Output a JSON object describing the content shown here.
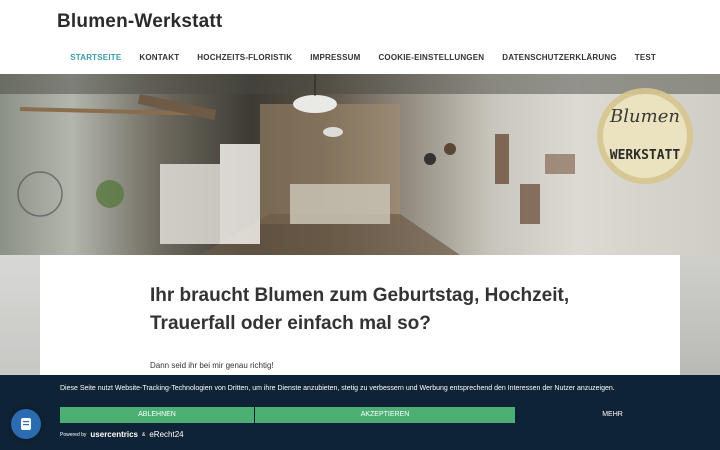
{
  "site": {
    "title": "Blumen-Werkstatt"
  },
  "nav": {
    "items": [
      {
        "label": "STARTSEITE",
        "active": true
      },
      {
        "label": "KONTAKT"
      },
      {
        "label": "HOCHZEITS-FLORISTIK"
      },
      {
        "label": "IMPRESSUM"
      },
      {
        "label": "COOKIE-EINSTELLUNGEN"
      },
      {
        "label": "DATENSCHUTZERKLÄRUNG"
      },
      {
        "label": "TEST"
      }
    ]
  },
  "hero": {
    "logo_text_1": "Blumen",
    "logo_text_2": "WERKSTATT"
  },
  "main": {
    "headline": "Ihr braucht Blumen zum Geburtstag, Hochzeit, Trauerfall oder einfach mal so?",
    "intro": "Dann seid ihr bei mir genau richtig!"
  },
  "cookie": {
    "text": "Diese Seite nutzt Website-Tracking-Technologien von Dritten, um ihre Dienste anzubieten, stetig zu verbessern und Werbung entsprechend den Interessen der Nutzer anzuzeigen.",
    "deny": "ABLEHNEN",
    "accept": "AKZEPTIEREN",
    "more": "MEHR",
    "powered_by": "Powered by",
    "brand1": "usercentrics",
    "amp": "&",
    "brand2": "eRecht24"
  },
  "colors": {
    "accent": "#3c9ab0",
    "cookie_bg": "#0f2336",
    "button_green": "#4caf73"
  }
}
